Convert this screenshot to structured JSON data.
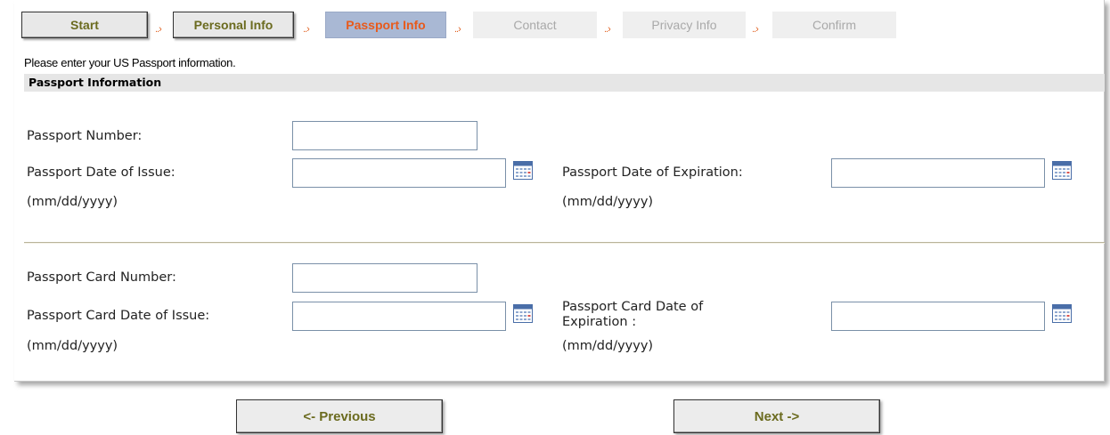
{
  "steps": [
    {
      "label": "Start",
      "state": "done"
    },
    {
      "label": "Personal Info",
      "state": "done"
    },
    {
      "label": "Passport Info",
      "state": "current"
    },
    {
      "label": "Contact",
      "state": "todo"
    },
    {
      "label": "Privacy Info",
      "state": "todo"
    },
    {
      "label": "Confirm",
      "state": "todo"
    }
  ],
  "arrow_glyph": "..›",
  "instruction": "Please enter your US Passport information.",
  "section_title": "Passport Information",
  "passport": {
    "number_label": "Passport Number:",
    "number_value": "",
    "issue_label": "Passport Date of Issue:",
    "issue_value": "",
    "issue_format": "(mm/dd/yyyy)",
    "expiration_label": "Passport Date of Expiration:",
    "expiration_value": "",
    "expiration_format": "(mm/dd/yyyy)"
  },
  "card": {
    "number_label": "Passport Card Number:",
    "number_value": "",
    "issue_label": "Passport Card Date of Issue:",
    "issue_value": "",
    "issue_format": "(mm/dd/yyyy)",
    "expiration_label": "Passport Card Date of Expiration :",
    "expiration_value": "",
    "expiration_format": "(mm/dd/yyyy)"
  },
  "nav": {
    "previous_label": "<- Previous",
    "next_label": "Next ->"
  },
  "icons": {
    "calendar": "calendar-icon"
  },
  "colors": {
    "done_step_text": "#6b6b1f",
    "current_step_bg": "#a9b8d4",
    "current_step_text": "#e85a1b",
    "todo_step_text": "#a9a9a9",
    "section_bar": "#e6e6e6"
  }
}
